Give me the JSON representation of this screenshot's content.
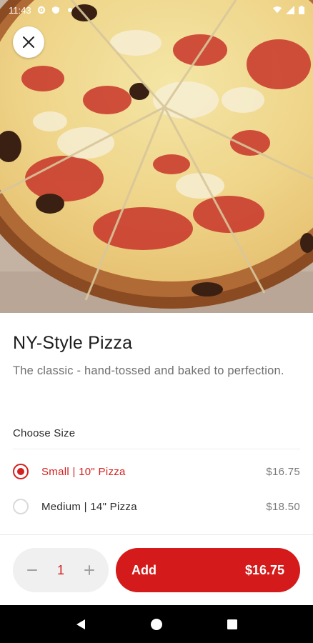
{
  "status_bar": {
    "time": "11:43",
    "left_icons": [
      "settings-gear-icon",
      "shield-icon",
      "notification-dot-icon"
    ],
    "right_icons": [
      "wifi-icon",
      "cell-signal-icon",
      "battery-icon"
    ]
  },
  "hero": {
    "image": "ny-style-pizza-photo",
    "close_icon": "close-icon"
  },
  "item": {
    "title": "NY-Style Pizza",
    "description": "The classic - hand-tossed and baked to perfection."
  },
  "size": {
    "heading": "Choose Size",
    "options": [
      {
        "label": "Small | 10\" Pizza",
        "price": "$16.75",
        "selected": true
      },
      {
        "label": "Medium | 14\" Pizza",
        "price": "$18.50",
        "selected": false
      }
    ]
  },
  "cart": {
    "quantity": "1",
    "decrement_icon": "minus-icon",
    "increment_icon": "plus-icon",
    "add_label": "Add",
    "add_price": "$16.75"
  },
  "nav": {
    "icons": [
      "back-triangle-icon",
      "home-circle-icon",
      "recents-square-icon"
    ]
  },
  "colors": {
    "accent": "#d41a1a",
    "selected_text": "#d42020",
    "muted_text": "#6f6f6f",
    "qty_bg": "#f0f0f0"
  }
}
